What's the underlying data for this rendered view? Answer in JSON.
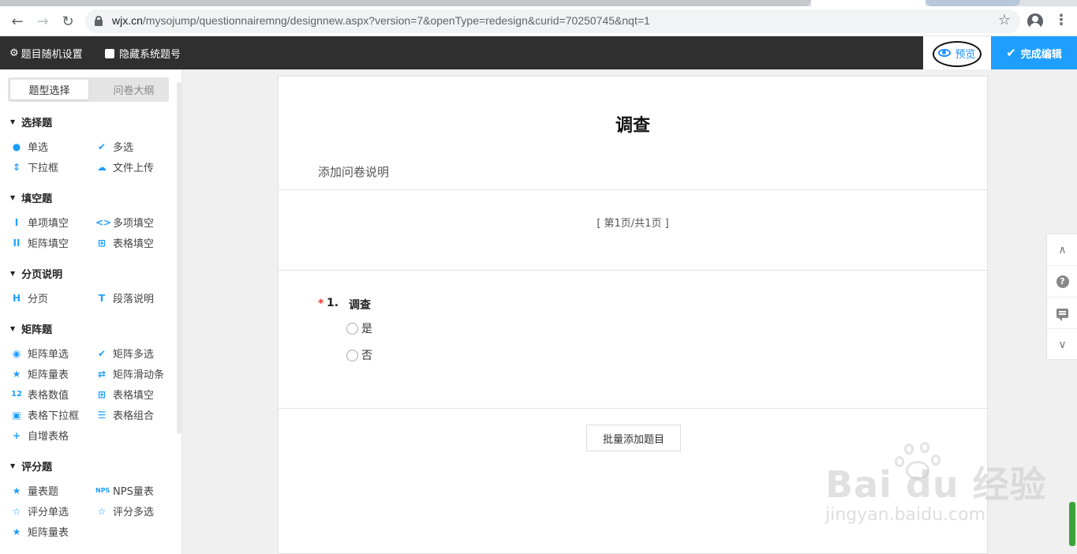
{
  "browser": {
    "url_host": "wjx.cn",
    "url_path": "/mysojump/questionnairemng/designnew.aspx?version=7&openType=redesign&curid=70250745&nqt=1"
  },
  "appbar": {
    "random_settings": "题目随机设置",
    "hide_numbers": "隐藏系统题号",
    "preview": "预览",
    "finish": "完成编辑"
  },
  "sidebar": {
    "tabs": [
      "题型选择",
      "问卷大纲"
    ],
    "groups": [
      {
        "title": "选择题",
        "items": [
          {
            "label": "单选",
            "icon": "dot-icon"
          },
          {
            "label": "多选",
            "icon": "check-icon"
          },
          {
            "label": "下拉框",
            "icon": "updown-icon"
          },
          {
            "label": "文件上传",
            "icon": "cloud-upload-icon"
          }
        ]
      },
      {
        "title": "填空题",
        "items": [
          {
            "label": "单项填空",
            "icon": "text-cursor-icon"
          },
          {
            "label": "多项填空",
            "icon": "brackets-icon"
          },
          {
            "label": "矩阵填空",
            "icon": "double-cursor-icon"
          },
          {
            "label": "表格填空",
            "icon": "table-icon"
          }
        ]
      },
      {
        "title": "分页说明",
        "items": [
          {
            "label": "分页",
            "icon": "page-break-icon"
          },
          {
            "label": "段落说明",
            "icon": "paragraph-icon"
          }
        ]
      },
      {
        "title": "矩阵题",
        "items": [
          {
            "label": "矩阵单选",
            "icon": "matrix-radio-icon"
          },
          {
            "label": "矩阵多选",
            "icon": "matrix-check-icon"
          },
          {
            "label": "矩阵量表",
            "icon": "matrix-scale-icon"
          },
          {
            "label": "矩阵滑动条",
            "icon": "slider-icon"
          },
          {
            "label": "表格数值",
            "icon": "numeric-icon"
          },
          {
            "label": "表格填空",
            "icon": "table-icon"
          },
          {
            "label": "表格下拉框",
            "icon": "dropdown-box-icon"
          },
          {
            "label": "表格组合",
            "icon": "table-combo-icon"
          },
          {
            "label": "自增表格",
            "icon": "plus-icon"
          }
        ]
      },
      {
        "title": "评分题",
        "items": [
          {
            "label": "量表题",
            "icon": "star-icon"
          },
          {
            "label": "NPS量表",
            "icon": "nps-icon"
          },
          {
            "label": "评分单选",
            "icon": "star-outline-icon"
          },
          {
            "label": "评分多选",
            "icon": "star-outline-icon"
          },
          {
            "label": "矩阵量表",
            "icon": "matrix-scale-icon"
          }
        ]
      }
    ]
  },
  "form": {
    "title": "调查",
    "description": "添加问卷说明",
    "page_indicator": "[ 第1页/共1页 ]",
    "question": {
      "required_mark": "*",
      "number": "1.",
      "text": "调查",
      "options": [
        "是",
        "否"
      ]
    },
    "batch_add": "批量添加题目"
  },
  "watermark": {
    "main": "Bai du 经验",
    "sub": "jingyan.baidu.com"
  },
  "colors": {
    "accent": "#1e9fff",
    "appbar": "#2f2f2f",
    "required": "#e53935"
  }
}
